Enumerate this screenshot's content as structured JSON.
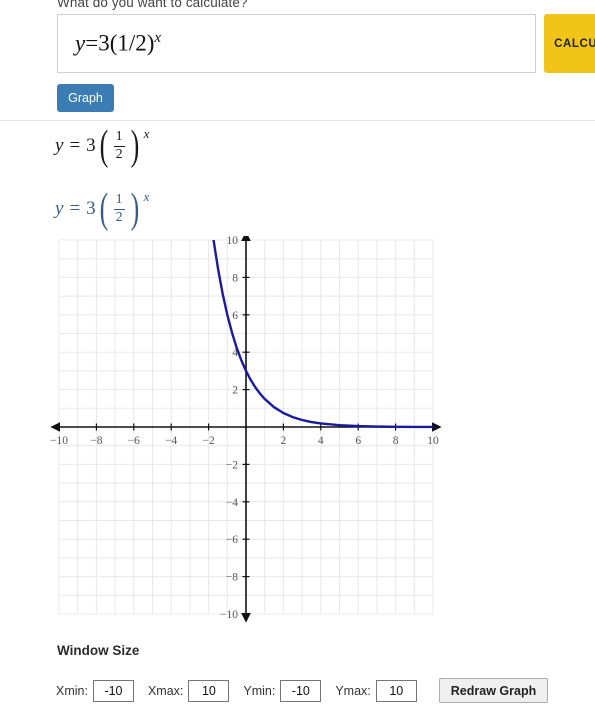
{
  "prompt": {
    "label": "What do you want to calculate?"
  },
  "input": {
    "name": "expression-input",
    "value_lhs": "y",
    "value_eq": "=",
    "value_base": "3(1/2)",
    "value_exp": "x",
    "value_plain": "y = 3(1/2)^x"
  },
  "buttons": {
    "calculate": "CALCULATE",
    "graph": "Graph",
    "redraw": "Redraw Graph"
  },
  "equations": [
    {
      "lhs": "y",
      "eq": "=",
      "coef": "3",
      "open": "(",
      "num": "1",
      "den": "2",
      "close": ")",
      "exp": "x",
      "color": "#1a1a1a"
    },
    {
      "lhs": "y",
      "eq": "=",
      "coef": "3",
      "open": "(",
      "num": "1",
      "den": "2",
      "close": ")",
      "exp": "x",
      "color": "#3a5a8c"
    }
  ],
  "window_size": {
    "title": "Window Size",
    "fields": [
      {
        "label": "Xmin:",
        "value": "-10",
        "name": "xmin-input"
      },
      {
        "label": "Xmax:",
        "value": "10",
        "name": "xmax-input"
      },
      {
        "label": "Ymin:",
        "value": "-10",
        "name": "ymin-input"
      },
      {
        "label": "Ymax:",
        "value": "10",
        "name": "ymax-input"
      }
    ]
  },
  "chart_data": {
    "type": "line",
    "title": "",
    "xlabel": "",
    "ylabel": "",
    "xlim": [
      -10,
      10
    ],
    "ylim": [
      -10,
      10
    ],
    "grid": true,
    "legend": false,
    "xticks": [
      -10,
      -8,
      -6,
      -4,
      -2,
      2,
      4,
      6,
      8,
      10
    ],
    "yticks": [
      10,
      8,
      6,
      4,
      2,
      -2,
      -4,
      -6,
      -8,
      -10
    ],
    "xtick_labels": [
      "−10",
      "−8",
      "−6",
      "−4",
      "−2",
      "2",
      "4",
      "6",
      "8",
      "10"
    ],
    "ytick_labels": [
      "10",
      "8",
      "6",
      "4",
      "2",
      "−2",
      "−4",
      "−6",
      "−8",
      "−10"
    ],
    "series": [
      {
        "name": "y = 3(1/2)^x",
        "color": "#1a1a9e",
        "equation": "y = 3*(0.5)^x",
        "x": [
          -1.75,
          -1.5,
          -1.25,
          -1.0,
          -0.75,
          -0.5,
          -0.25,
          0,
          0.25,
          0.5,
          0.75,
          1.0,
          1.5,
          2.0,
          2.5,
          3.0,
          3.5,
          4.0,
          5.0,
          6.0,
          7.0,
          8.0,
          9.0,
          10.0
        ],
        "y": [
          10.09,
          8.49,
          7.13,
          6.0,
          5.05,
          4.24,
          3.57,
          3.0,
          2.52,
          2.12,
          1.78,
          1.5,
          1.06,
          0.75,
          0.53,
          0.375,
          0.265,
          0.1875,
          0.094,
          0.047,
          0.023,
          0.012,
          0.006,
          0.003
        ]
      }
    ]
  }
}
